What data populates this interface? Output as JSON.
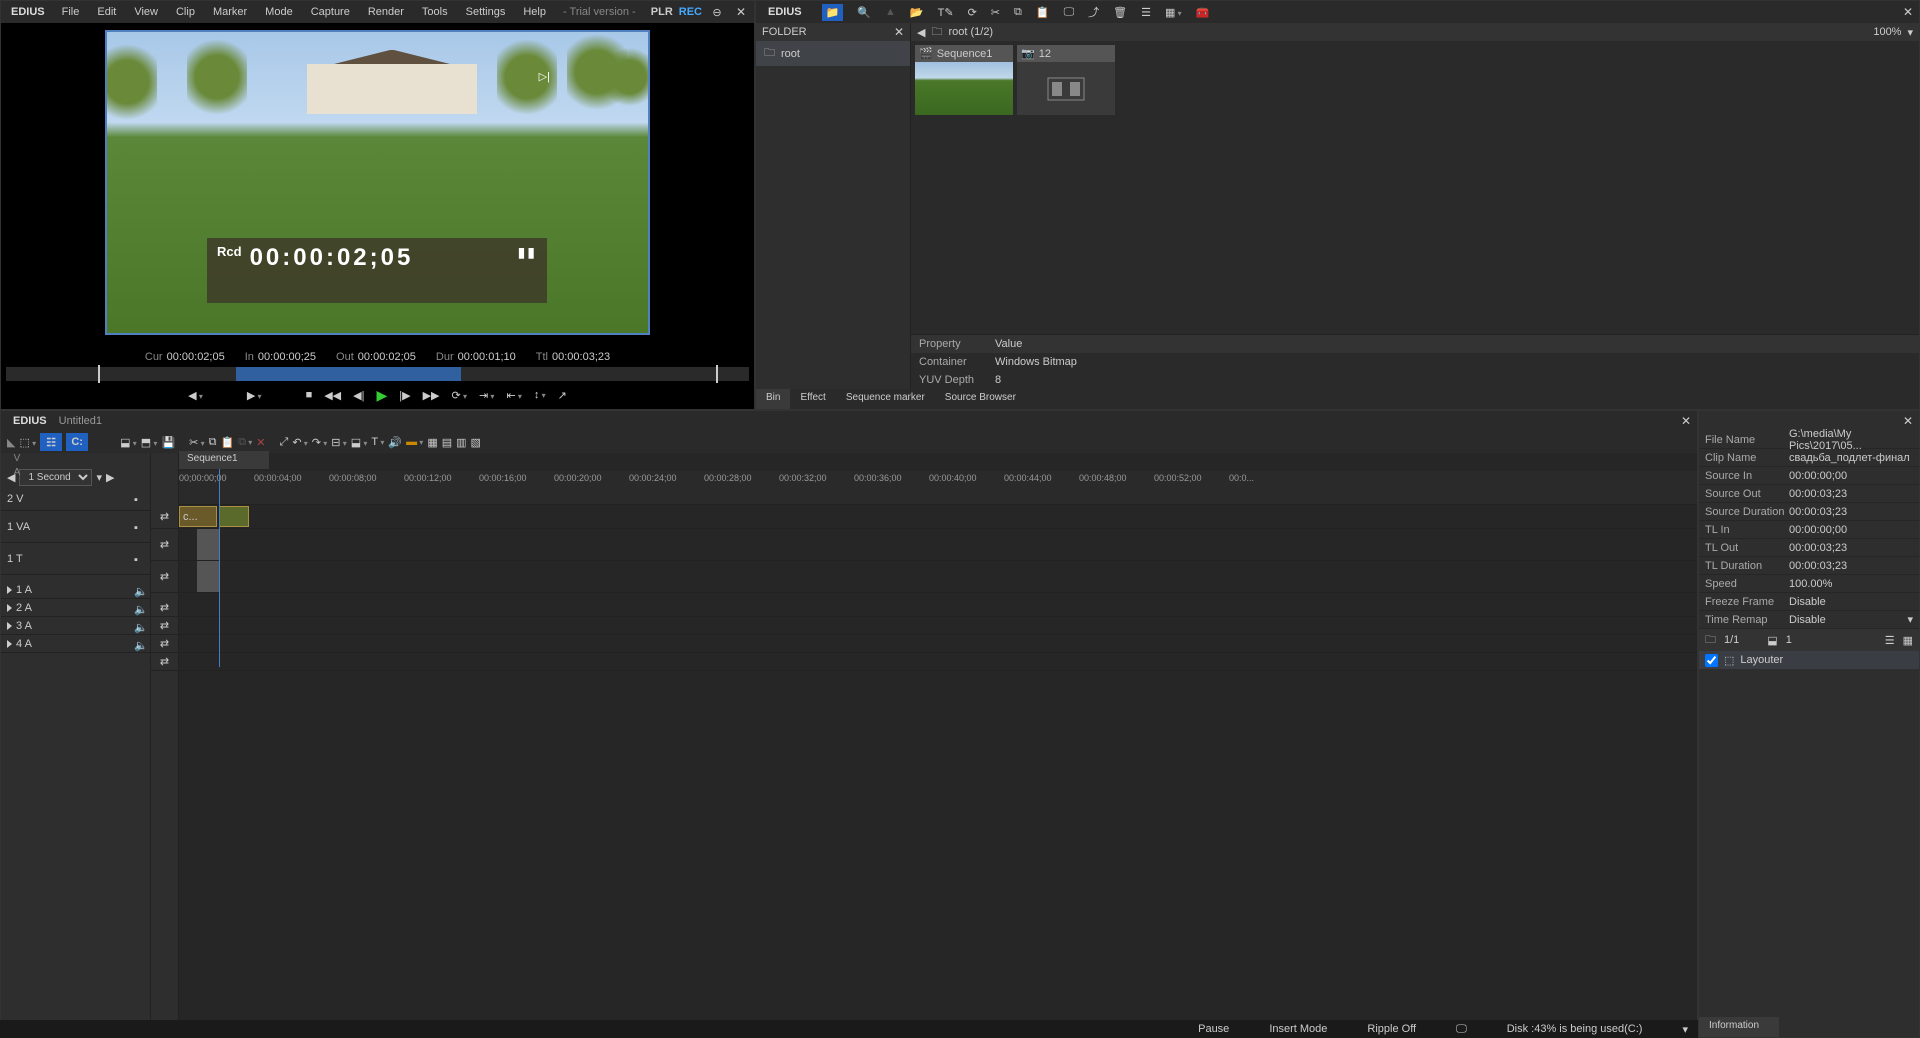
{
  "app_name": "EDIUS",
  "menu": [
    "File",
    "Edit",
    "View",
    "Clip",
    "Marker",
    "Mode",
    "Capture",
    "Render",
    "Tools",
    "Settings",
    "Help"
  ],
  "trial": "- Trial version -",
  "plr": "PLR",
  "rec": "REC",
  "overlay": {
    "label": "Rcd",
    "tc": "00:00:02;05"
  },
  "tc_row": {
    "cur_l": "Cur",
    "cur_v": "00:00:02;05",
    "in_l": "In",
    "in_v": "00:00:00;25",
    "out_l": "Out",
    "out_v": "00:00:02;05",
    "dur_l": "Dur",
    "dur_v": "00:00:01;10",
    "ttl_l": "Ttl",
    "ttl_v": "00:00:03;23"
  },
  "folder_header": "FOLDER",
  "folder_root": "root",
  "bin_path": "root (1/2)",
  "zoom": "100%",
  "thumbs": [
    {
      "title": "Sequence1"
    },
    {
      "title": "12"
    }
  ],
  "props": {
    "header_k": "Property",
    "header_v": "Value",
    "rows": [
      {
        "k": "Container",
        "v": "Windows Bitmap"
      },
      {
        "k": "YUV Depth",
        "v": "8"
      }
    ]
  },
  "bin_tabs": [
    "Bin",
    "Effect",
    "Sequence marker",
    "Source Browser"
  ],
  "tl_title": "Untitled1",
  "seq_tab": "Sequence1",
  "scale": "1 Second",
  "va": {
    "v": "V",
    "a": "A"
  },
  "ruler": [
    "00;00:00;00",
    "00:00:04;00",
    "00:00:08;00",
    "00:00:12;00",
    "00:00:16;00",
    "00:00:20;00",
    "00:00:24;00",
    "00:00:28;00",
    "00:00:32;00",
    "00:00:36;00",
    "00:00:40;00",
    "00:00:44;00",
    "00:00:48;00",
    "00:00:52;00",
    "00:0..."
  ],
  "tracks": [
    "2 V",
    "1 VA",
    "1 T",
    "1 A",
    "2 A",
    "3 A",
    "4 A"
  ],
  "clip_label": "с...",
  "info": [
    {
      "k": "File Name",
      "v": "G:\\media\\My Pics\\2017\\05..."
    },
    {
      "k": "Clip Name",
      "v": "свадьба_подлет-финал"
    },
    {
      "k": "Source In",
      "v": "00:00:00;00"
    },
    {
      "k": "Source Out",
      "v": "00:00:03;23"
    },
    {
      "k": "Source Duration",
      "v": "00:00:03;23"
    },
    {
      "k": "TL In",
      "v": "00:00:00;00"
    },
    {
      "k": "TL Out",
      "v": "00:00:03;23"
    },
    {
      "k": "TL Duration",
      "v": "00:00:03;23"
    },
    {
      "k": "Speed",
      "v": "100.00%"
    },
    {
      "k": "Freeze Frame",
      "v": "Disable"
    },
    {
      "k": "Time Remap",
      "v": "Disable"
    }
  ],
  "info_counts": {
    "a": "1/1",
    "b": "1"
  },
  "layouter": "Layouter",
  "info_tab": "Information",
  "status": {
    "pause": "Pause",
    "insert": "Insert Mode",
    "ripple": "Ripple Off",
    "disk": "Disk :43% is being used(C:)"
  }
}
